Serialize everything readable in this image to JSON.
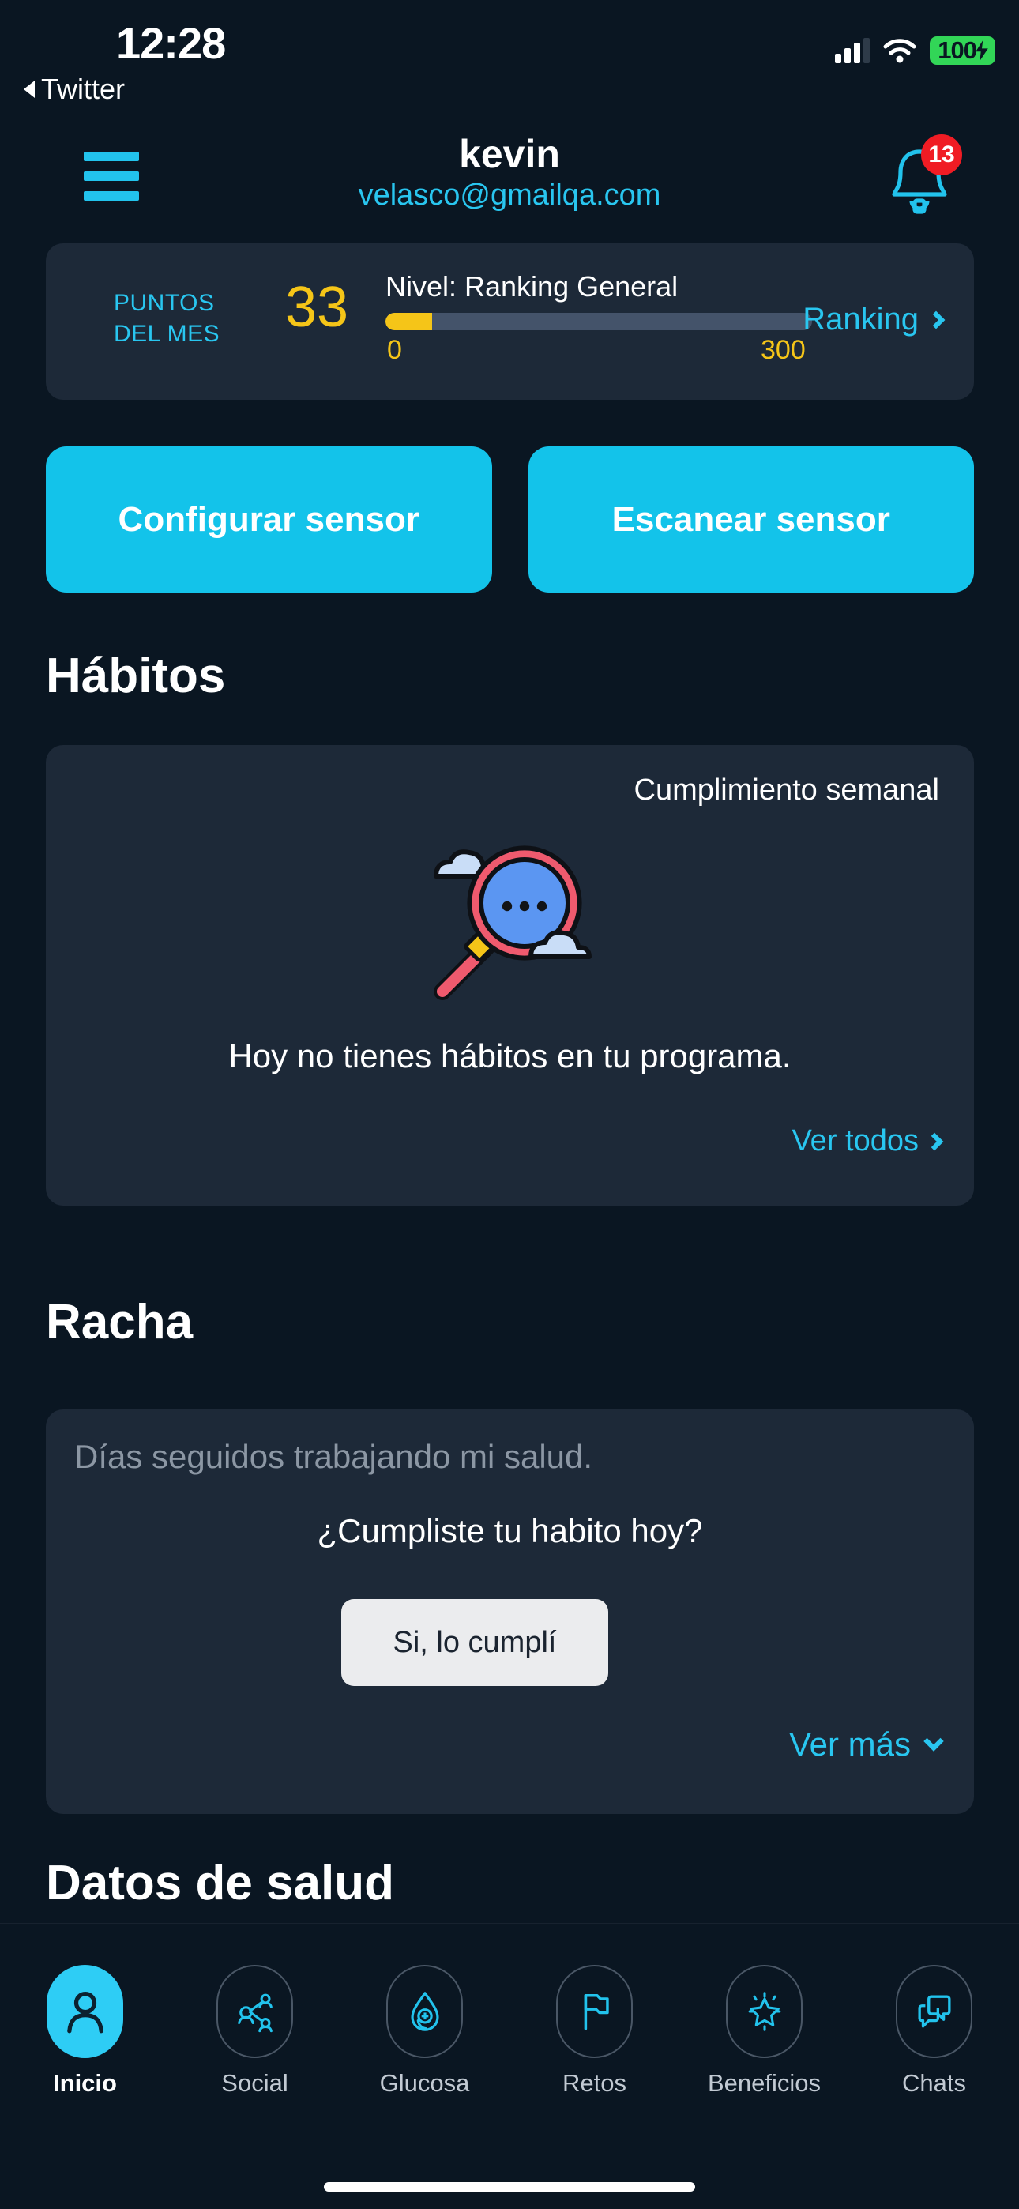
{
  "status_bar": {
    "time": "12:28",
    "back_app": "Twitter",
    "battery_percent": "100",
    "signal_icon": "cellular-signal-icon",
    "wifi_icon": "wifi-icon",
    "battery_icon": "battery-charging-icon"
  },
  "header": {
    "menu_icon": "hamburger-menu-icon",
    "title": "kevin",
    "email": "velasco@gmailqa.com",
    "bell_icon": "notification-bell-icon",
    "notification_count": "13"
  },
  "points_card": {
    "label": "PUNTOS\nDEL MES",
    "label_line1": "PUNTOS",
    "label_line2": "DEL MES",
    "value": "33",
    "level_label": "Nivel: Ranking General",
    "progress_min": "0",
    "progress_max": "300",
    "progress_percent": 11,
    "ranking_link": "Ranking",
    "chevron_icon": "chevron-right-icon"
  },
  "actions": {
    "configure_sensor": "Configurar sensor",
    "scan_sensor": "Escanear sensor"
  },
  "habits": {
    "section_title": "Hábitos",
    "weekly_label": "Cumplimiento semanal",
    "illustration_icon": "magnifier-search-illustration",
    "empty_text": "Hoy no tienes hábitos en tu programa.",
    "see_all": "Ver todos",
    "chevron_icon": "chevron-right-icon"
  },
  "racha": {
    "section_title": "Racha",
    "subtitle": "Días seguidos trabajando mi salud.",
    "question": "¿Cumpliste tu habito hoy?",
    "yes_button": "Si, lo cumplí",
    "see_more": "Ver más",
    "chevron_icon": "chevron-down-icon"
  },
  "datos_salud": {
    "section_title": "Datos de salud"
  },
  "tab_bar": {
    "items": [
      {
        "label": "Inicio",
        "icon": "person-icon",
        "active": true
      },
      {
        "label": "Social",
        "icon": "network-nodes-icon",
        "active": false
      },
      {
        "label": "Glucosa",
        "icon": "blood-drop-icon",
        "active": false
      },
      {
        "label": "Retos",
        "icon": "flag-icon",
        "active": false
      },
      {
        "label": "Beneficios",
        "icon": "star-icon",
        "active": false
      },
      {
        "label": "Chats",
        "icon": "chat-bubbles-icon",
        "active": false
      }
    ]
  },
  "colors": {
    "background": "#0a1622",
    "card": "#1d2938",
    "accent_cyan": "#22c3ed",
    "accent_yellow": "#f5c518",
    "badge_red": "#f01c24",
    "battery_green": "#32d657"
  }
}
